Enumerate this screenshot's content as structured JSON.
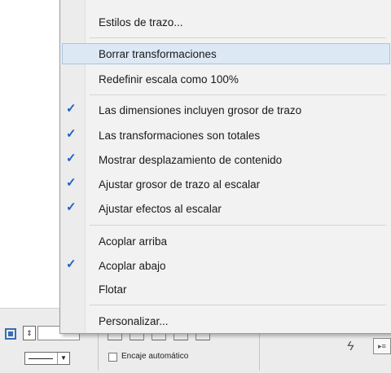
{
  "menu": {
    "items": [
      {
        "label": "Estilos de trazo...",
        "checked": false
      },
      {
        "label": "Borrar transformaciones",
        "checked": false,
        "highlighted": true
      },
      {
        "label": "Redefinir escala como 100%",
        "checked": false
      },
      {
        "label": "Las dimensiones incluyen grosor de trazo",
        "checked": true
      },
      {
        "label": "Las transformaciones son totales",
        "checked": true
      },
      {
        "label": "Mostrar desplazamiento de contenido",
        "checked": true
      },
      {
        "label": "Ajustar grosor de trazo al escalar",
        "checked": true
      },
      {
        "label": "Ajustar efectos al escalar",
        "checked": true
      },
      {
        "label": "Acoplar arriba",
        "checked": false
      },
      {
        "label": "Acoplar abajo",
        "checked": true
      },
      {
        "label": "Flotar",
        "checked": false
      },
      {
        "label": "Personalizar...",
        "checked": false
      }
    ],
    "check_glyph": "✓",
    "check_color": "#1f5fc8",
    "highlight_color": "#dde8f5"
  },
  "panel": {
    "auto_fit_label": "Encaje automático",
    "auto_fit_checked": false,
    "stepper_glyph": "⇕",
    "dropdown_glyph": "▼",
    "bolt_glyph": "ϟ",
    "panel_button_glyph": "▸≡"
  }
}
